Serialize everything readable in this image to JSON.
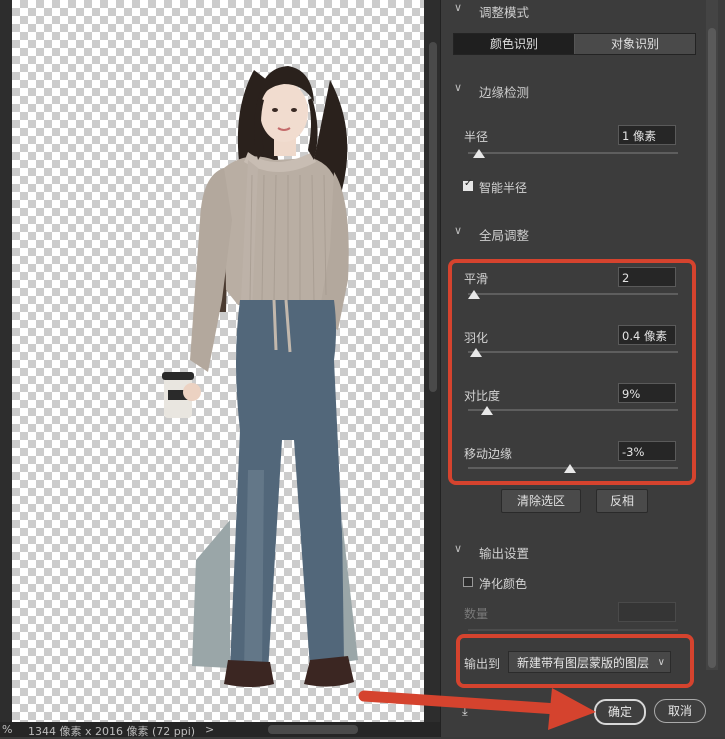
{
  "status": {
    "zoom_suffix": "%",
    "doc_info": "1344 像素 x 2016 像素 (72 ppi)",
    "chevron": ">"
  },
  "mode_section": {
    "title": "调整模式",
    "options": [
      "颜色识别",
      "对象识别"
    ],
    "selected_index": 0
  },
  "edge_detection": {
    "title": "边缘检测",
    "radius_label": "半径",
    "radius_value": "1 像素",
    "radius_level": 0.05,
    "smart_radius_label": "智能半径",
    "smart_radius_checked": true
  },
  "global_refine": {
    "title": "全局调整",
    "sliders": [
      {
        "label": "平滑",
        "value": "2",
        "level": 0.03
      },
      {
        "label": "羽化",
        "value": "0.4 像素",
        "level": 0.04
      },
      {
        "label": "对比度",
        "value": "9%",
        "level": 0.09
      },
      {
        "label": "移动边缘",
        "value": "-3%",
        "level": 0.485
      }
    ]
  },
  "actions": {
    "clear_selection": "清除选区",
    "invert": "反相"
  },
  "output": {
    "title": "输出设置",
    "decontaminate_label": "净化颜色",
    "decontaminate_checked": false,
    "amount_label": "数量",
    "output_to_label": "输出到",
    "output_to_value": "新建带有图层蒙版的图层"
  },
  "footer": {
    "ok": "确定",
    "cancel": "取消"
  },
  "colors": {
    "annotation_red": "#d5432e",
    "panel_bg": "#3c3c3c"
  }
}
